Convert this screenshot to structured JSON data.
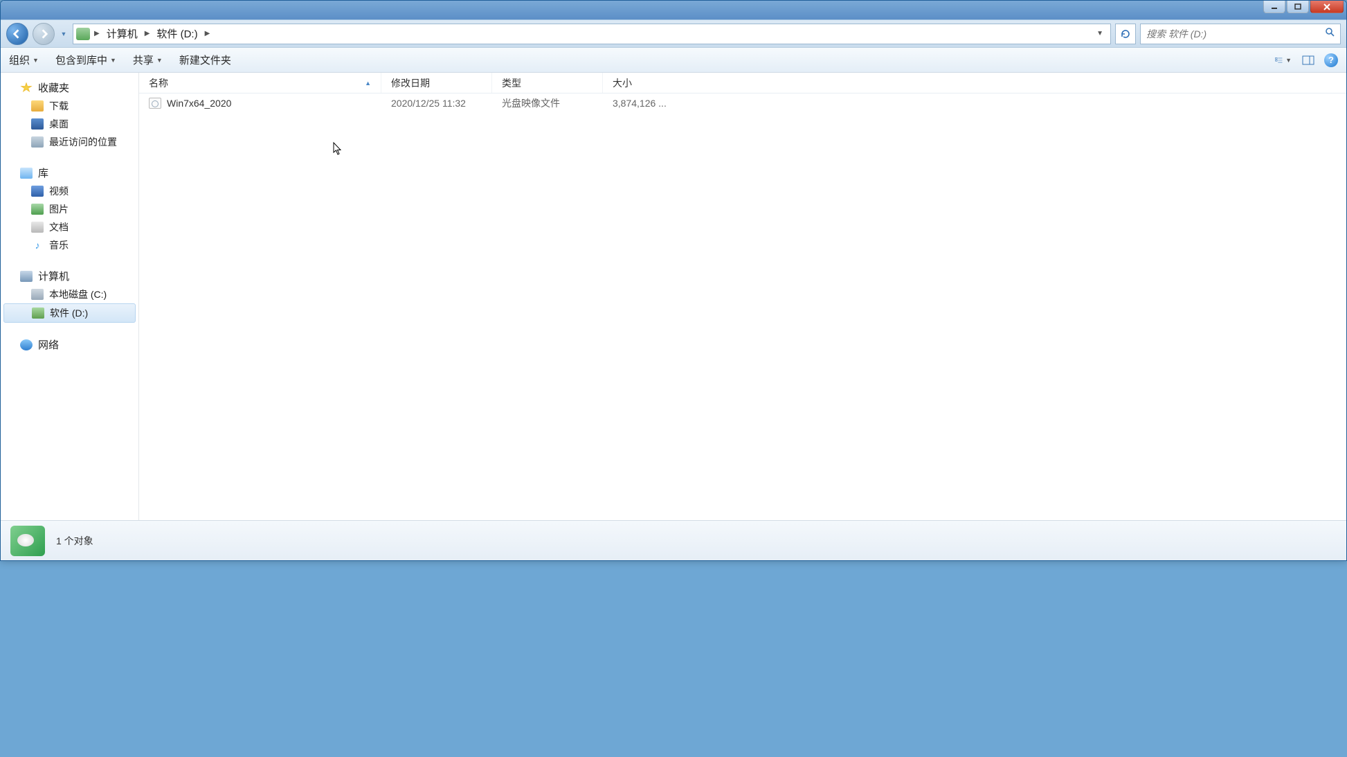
{
  "titlebar": {},
  "breadcrumb": {
    "computer": "计算机",
    "drive": "软件 (D:)"
  },
  "search": {
    "placeholder": "搜索 软件 (D:)"
  },
  "toolbar": {
    "organize": "组织",
    "include": "包含到库中",
    "share": "共享",
    "newfolder": "新建文件夹"
  },
  "sidebar": {
    "favorites": {
      "header": "收藏夹",
      "downloads": "下载",
      "desktop": "桌面",
      "recent": "最近访问的位置"
    },
    "libraries": {
      "header": "库",
      "videos": "视频",
      "pictures": "图片",
      "documents": "文档",
      "music": "音乐"
    },
    "computer": {
      "header": "计算机",
      "cdrive": "本地磁盘 (C:)",
      "ddrive": "软件 (D:)"
    },
    "network": {
      "header": "网络"
    }
  },
  "columns": {
    "name": "名称",
    "date": "修改日期",
    "type": "类型",
    "size": "大小"
  },
  "files": [
    {
      "name": "Win7x64_2020",
      "date": "2020/12/25 11:32",
      "type": "光盘映像文件",
      "size": "3,874,126 ..."
    }
  ],
  "status": {
    "count": "1 个对象"
  }
}
